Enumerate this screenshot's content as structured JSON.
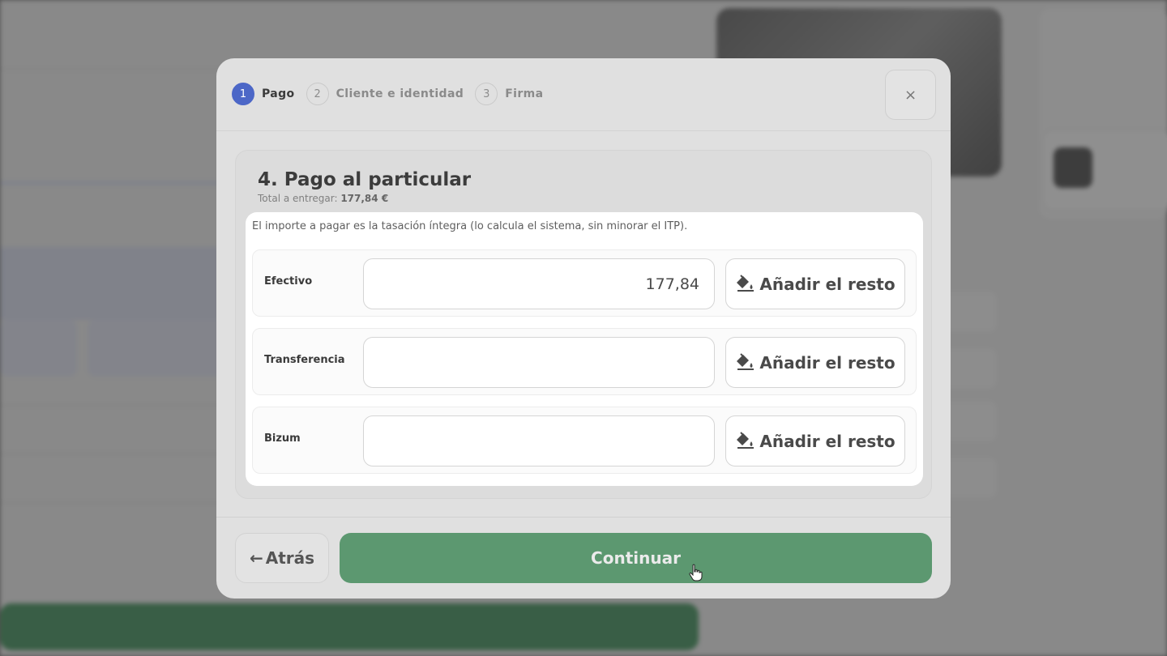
{
  "steps": [
    {
      "num": "1",
      "label": "Pago",
      "active": true
    },
    {
      "num": "2",
      "label": "Cliente e identidad",
      "active": false
    },
    {
      "num": "3",
      "label": "Firma",
      "active": false
    }
  ],
  "close_icon": "×",
  "section": {
    "title": "4. Pago al particular",
    "total_label": "Total a entregar:",
    "total_value": "177,84 €",
    "note": "El importe a pagar es la tasación íntegra (lo calcula el sistema, sin minorar el ITP)."
  },
  "payments": [
    {
      "label": "Efectivo",
      "value": "177,84",
      "button": "Añadir el resto",
      "icon": "paint-bucket-icon"
    },
    {
      "label": "Transferencia",
      "value": "",
      "button": "Añadir el resto",
      "icon": "paint-bucket-icon"
    },
    {
      "label": "Bizum",
      "value": "",
      "button": "Añadir el resto",
      "icon": "paint-bucket-icon"
    }
  ],
  "footer": {
    "back_label": "Atrás",
    "back_icon": "←",
    "continue_label": "Continuar"
  },
  "colors": {
    "active_step": "#4c67c7",
    "continue_bg": "#5c9870"
  }
}
